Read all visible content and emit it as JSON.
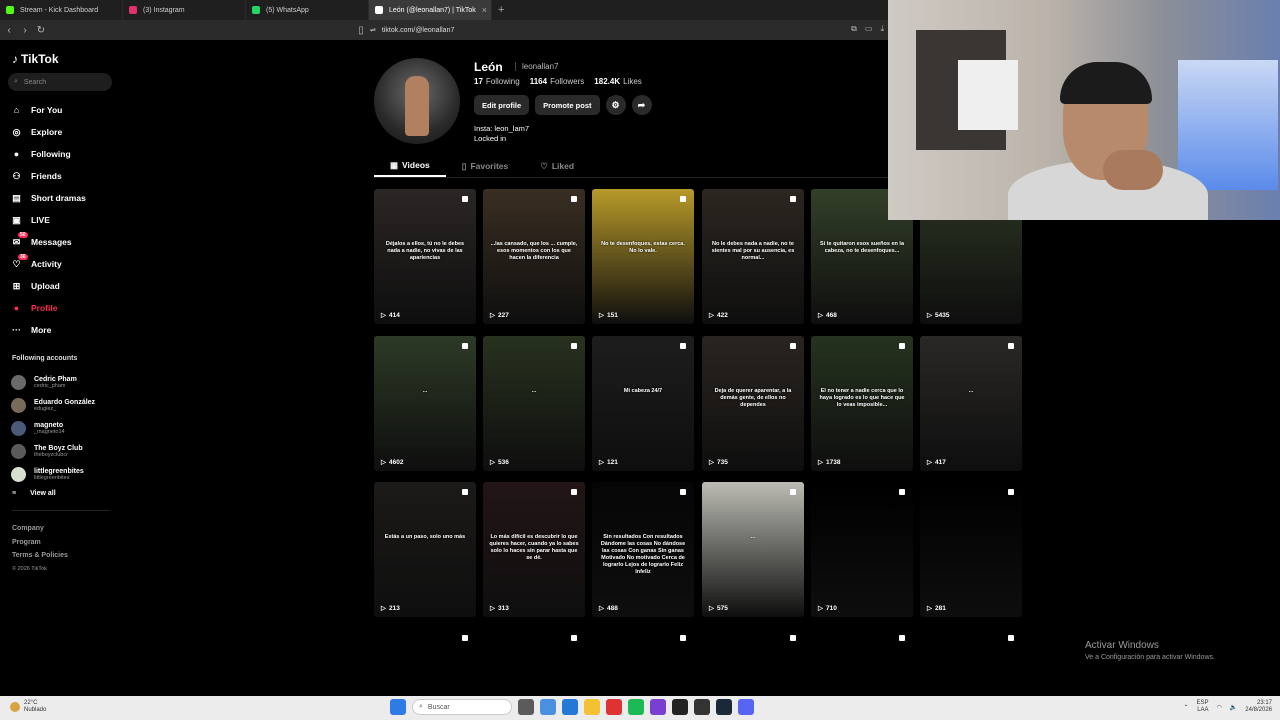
{
  "browser": {
    "tabs": [
      {
        "title": "Stream - Kick Dashboard",
        "color": "#53fc18"
      },
      {
        "title": "(3) Instagram",
        "color": "#e1306c"
      },
      {
        "title": "(5) WhatsApp",
        "color": "#25d366"
      },
      {
        "title": "León (@leonallan7) | TikTok",
        "color": "#ffffff",
        "active": true
      }
    ],
    "new_tab": "+",
    "close": "×",
    "url": "tiktok.com/@leonallan7"
  },
  "sidebar": {
    "logo": "TikTok",
    "search_placeholder": "Search",
    "menu": [
      {
        "label": "For You",
        "icon": "home-icon"
      },
      {
        "label": "Explore",
        "icon": "compass-icon"
      },
      {
        "label": "Following",
        "icon": "following-avatar-icon"
      },
      {
        "label": "Friends",
        "icon": "friends-icon"
      },
      {
        "label": "Short dramas",
        "icon": "drama-icon"
      },
      {
        "label": "LIVE",
        "icon": "live-icon"
      },
      {
        "label": "Messages",
        "icon": "messages-icon",
        "badge": "50"
      },
      {
        "label": "Activity",
        "icon": "activity-icon",
        "badge": "36"
      },
      {
        "label": "Upload",
        "icon": "upload-icon"
      },
      {
        "label": "Profile",
        "icon": "profile-avatar-icon",
        "active": true
      },
      {
        "label": "More",
        "icon": "more-icon"
      }
    ],
    "following_title": "Following accounts",
    "following": [
      {
        "name": "Cedric Pham",
        "handle": "cedric_pham"
      },
      {
        "name": "Eduardo González",
        "handle": "eduglez_"
      },
      {
        "name": "magneto",
        "handle": "_magneto14"
      },
      {
        "name": "The Boyz Club",
        "handle": "theboyzclubcr"
      },
      {
        "name": "littlegreenbites",
        "handle": "littlegreenbites"
      }
    ],
    "view_all": "View all",
    "footer": [
      "Company",
      "Program",
      "Terms & Policies"
    ],
    "copyright": "© 2026 TikTok"
  },
  "profile": {
    "name": "León",
    "handle": "leonallan7",
    "following_count": "17",
    "following_label": "Following",
    "followers_count": "1164",
    "followers_label": "Followers",
    "likes_count": "182.4K",
    "likes_label": "Likes",
    "edit_button": "Edit profile",
    "promote_button": "Promote post",
    "bio_line1": "Insta: leon_lam7",
    "bio_line2": "Locked in",
    "tabs": [
      "Videos",
      "Favorites",
      "Liked"
    ]
  },
  "videos": [
    {
      "views": "414",
      "caption": "Déjalos a ellos, tú no le debes nada a nadie, no vivas de las apariencias",
      "bg": "#2a2624"
    },
    {
      "views": "227",
      "caption": "...las cansado, que los ... cumple, esos momentos con los que hacen la diferencia",
      "bg": "#3a2e22"
    },
    {
      "views": "151",
      "caption": "No te desenfoques, estas cerca. No lo vale.",
      "bg": "#b89a2a"
    },
    {
      "views": "422",
      "caption": "No le debes nada a nadie, no te sientes mal por su ausencia, es normal...",
      "bg": "#2c2620"
    },
    {
      "views": "468",
      "caption": "Si te quitaron esos sueños en la cabeza, no te desenfoques...",
      "bg": "#334029"
    },
    {
      "views": "5435",
      "caption": "",
      "bg": "#2a3422"
    },
    {
      "views": "4602",
      "caption": "...",
      "bg": "#2d3a26"
    },
    {
      "views": "536",
      "caption": "...",
      "bg": "#28321f"
    },
    {
      "views": "121",
      "caption": "Mi cabeza 24/7",
      "bg": "#1d1d1d"
    },
    {
      "views": "735",
      "caption": "Deja de querer aparentar, a la demás gente, de ellos no dependes",
      "bg": "#2a2420"
    },
    {
      "views": "1738",
      "caption": "El no tener a nadie cerca que lo haya logrado es lo que hace que lo veas imposible...",
      "bg": "#26331f"
    },
    {
      "views": "417",
      "caption": "...",
      "bg": "#2a2826"
    },
    {
      "views": "213",
      "caption": "Estás a un paso, solo uno más",
      "bg": "#1c1a18"
    },
    {
      "views": "313",
      "caption": "Lo más difícil es descubrir lo que quieres hacer, cuando ya lo sabes solo lo haces sin parar hasta que se dé.",
      "bg": "#221516"
    },
    {
      "views": "488",
      "caption": "Sin resultados Con resultados Dándome las cosas No dándose las cosas Con ganas Sin ganas Motivado No motivado Cerca de lograrlo Lejos de lograrlo Feliz Infeliz",
      "bg": "#050505"
    },
    {
      "views": "575",
      "caption": "...",
      "bg": "#bcbcb4"
    },
    {
      "views": "710",
      "caption": "",
      "bg": "#000000"
    },
    {
      "views": "281",
      "caption": "",
      "bg": "#000000"
    }
  ],
  "watermark": {
    "title": "Activar Windows",
    "subtitle": "Ve a Configuración para activar Windows."
  },
  "taskbar": {
    "temp": "22°C",
    "weather": "Nublado",
    "search": "Buscar",
    "lang1": "ESP",
    "lang2": "LAA",
    "time": "23:17",
    "date": "24/8/2026"
  }
}
